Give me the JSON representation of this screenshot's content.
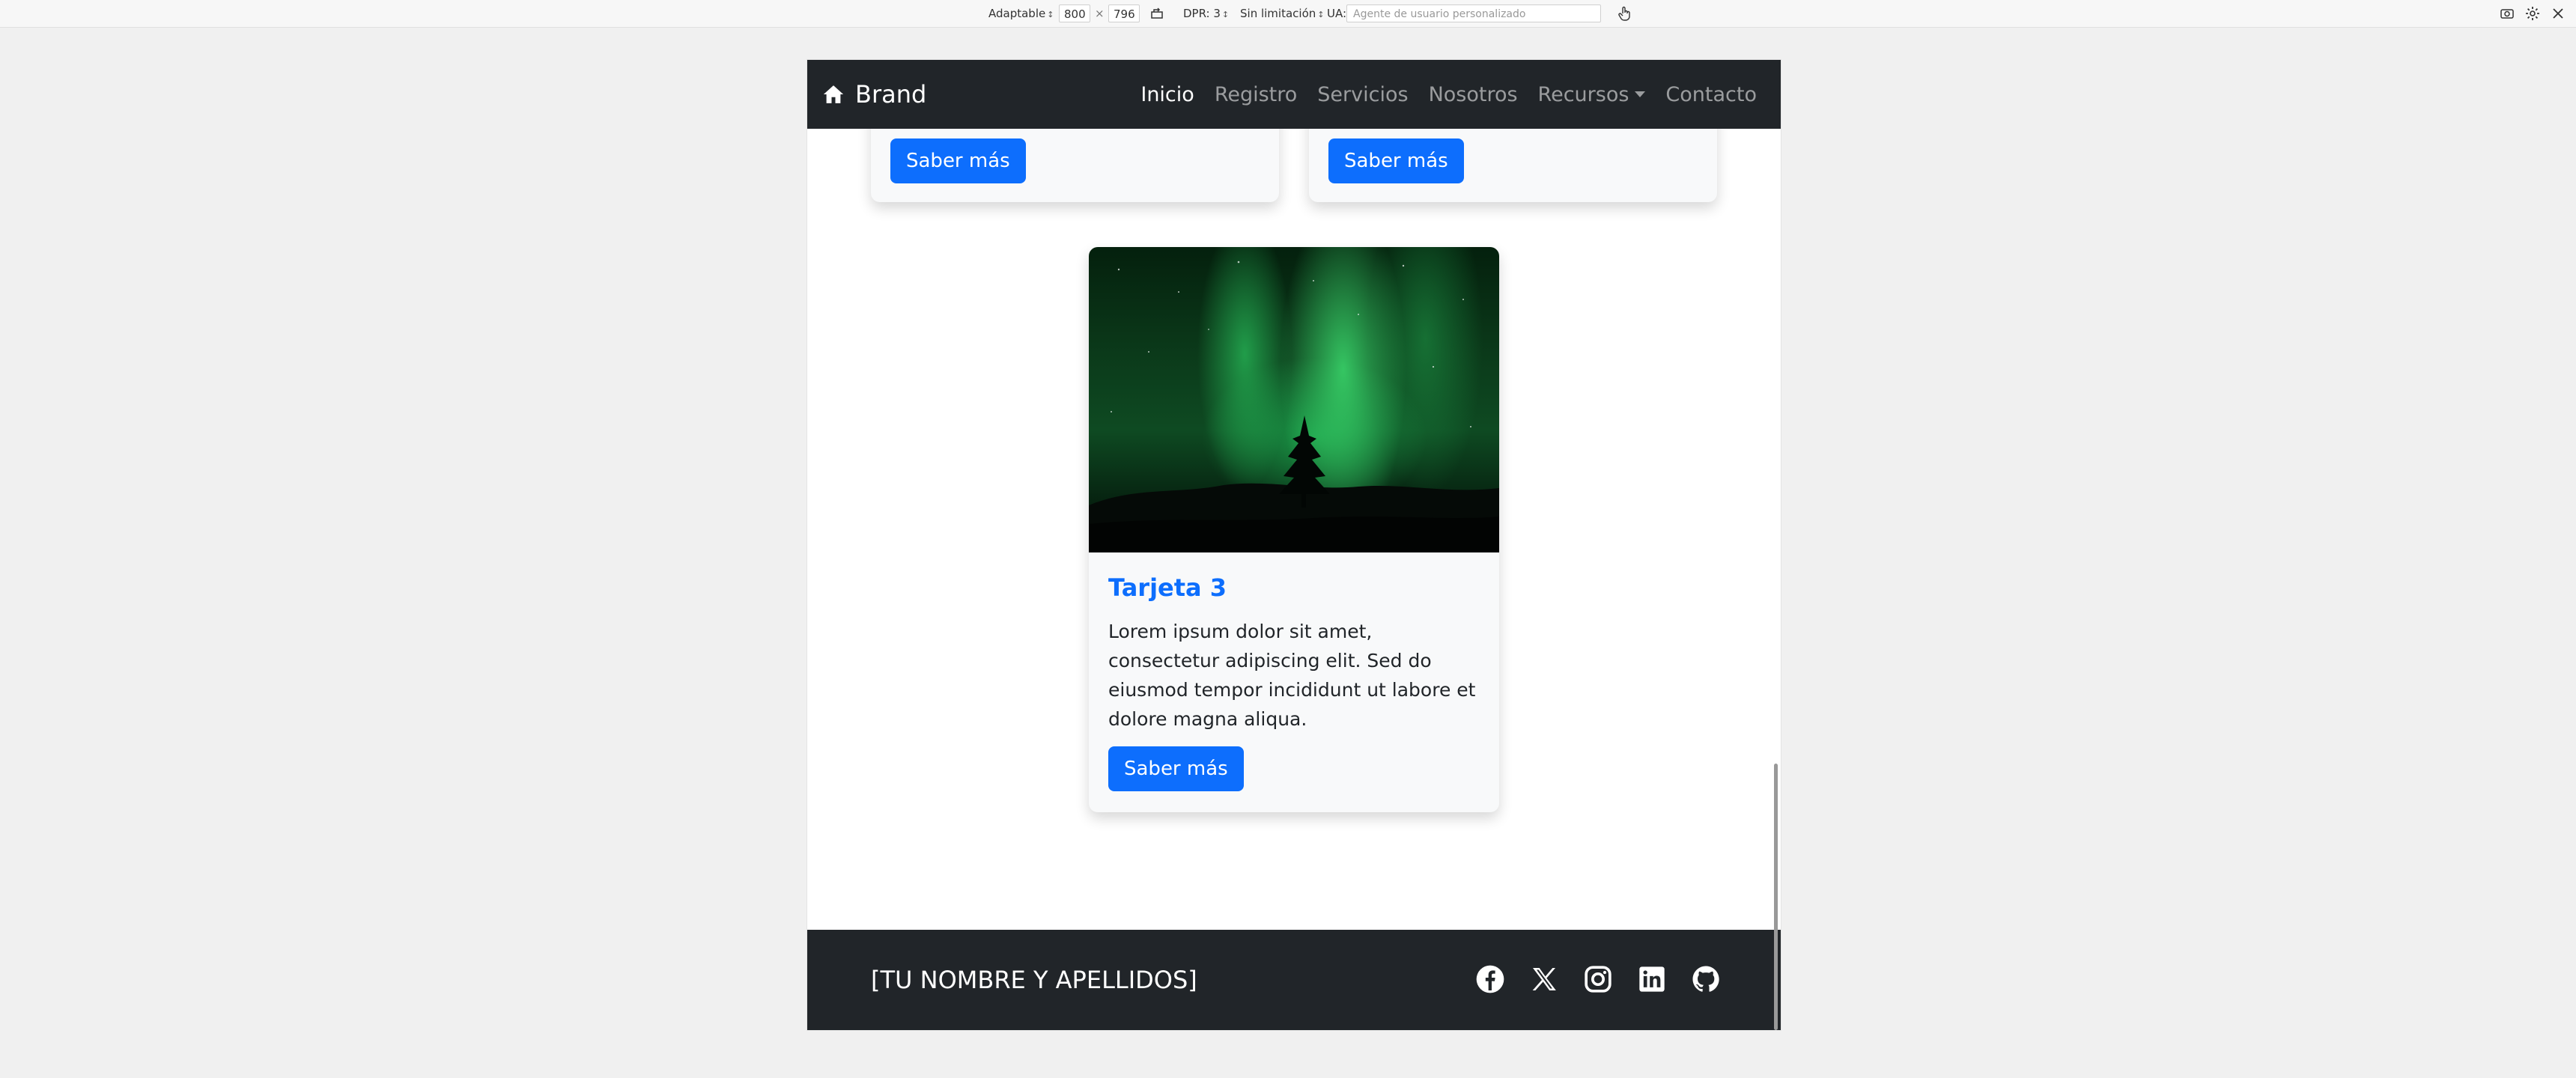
{
  "devtools": {
    "mode": "Adaptable",
    "width": "800",
    "separator": "×",
    "height": "796",
    "dpr": "DPR: 3",
    "throttling": "Sin limitación",
    "ua_label": "UA:",
    "ua_placeholder": "Agente de usuario personalizado"
  },
  "navbar": {
    "brand": "Brand",
    "links": [
      {
        "label": "Inicio",
        "active": true
      },
      {
        "label": "Registro"
      },
      {
        "label": "Servicios"
      },
      {
        "label": "Nosotros"
      },
      {
        "label": "Recursos",
        "dropdown": true
      },
      {
        "label": "Contacto"
      }
    ]
  },
  "cards": [
    {
      "button": "Saber más"
    },
    {
      "button": "Saber más"
    },
    {
      "title": "Tarjeta 3",
      "text": "Lorem ipsum dolor sit amet, consectetur adipiscing elit. Sed do eiusmod tempor incididunt ut labore et dolore magna aliqua.",
      "button": "Saber más"
    }
  ],
  "footer": {
    "name": "[TU NOMBRE Y APELLIDOS]",
    "socials": [
      "facebook-icon",
      "x-icon",
      "instagram-icon",
      "linkedin-icon",
      "github-icon"
    ]
  },
  "colors": {
    "navbar_bg": "#212529",
    "primary": "#0d6efd",
    "card_bg": "#f8f9fa"
  }
}
